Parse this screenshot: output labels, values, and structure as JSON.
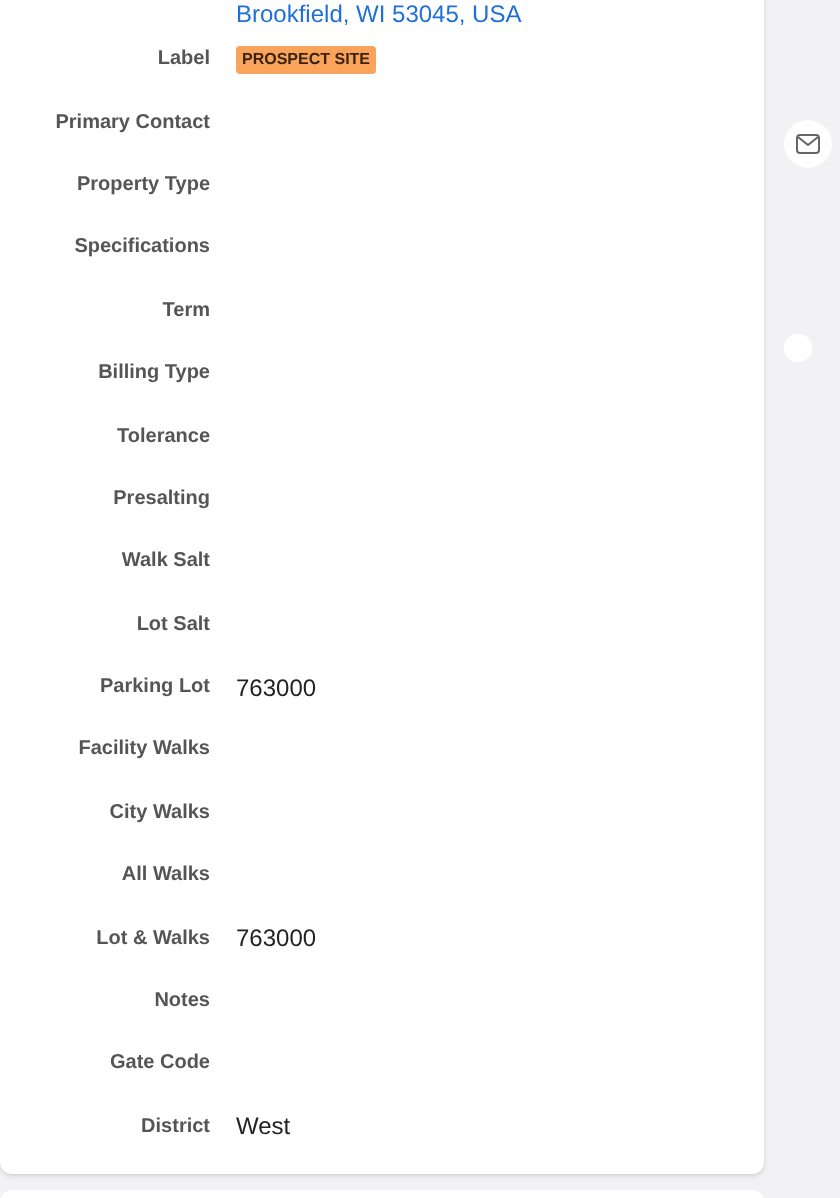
{
  "address": {
    "line": "Brookfield, WI 53045, USA"
  },
  "fields": [
    {
      "label": "Label",
      "kind": "badge",
      "value": "PROSPECT SITE",
      "color": "#f9a35b"
    },
    {
      "label": "Primary Contact"
    },
    {
      "label": "Property Type"
    },
    {
      "label": "Specifications"
    },
    {
      "label": "Term"
    },
    {
      "label": "Billing Type"
    },
    {
      "label": "Tolerance"
    },
    {
      "label": "Presalting"
    },
    {
      "label": "Walk Salt"
    },
    {
      "label": "Lot Salt"
    },
    {
      "label": "Parking Lot",
      "kind": "text",
      "value": "763000"
    },
    {
      "label": "Facility Walks"
    },
    {
      "label": "City Walks"
    },
    {
      "label": "All Walks"
    },
    {
      "label": "Lot & Walks",
      "kind": "text",
      "value": "763000"
    },
    {
      "label": "Notes"
    },
    {
      "label": "Gate Code"
    },
    {
      "label": "District",
      "kind": "text",
      "value": "West"
    }
  ]
}
